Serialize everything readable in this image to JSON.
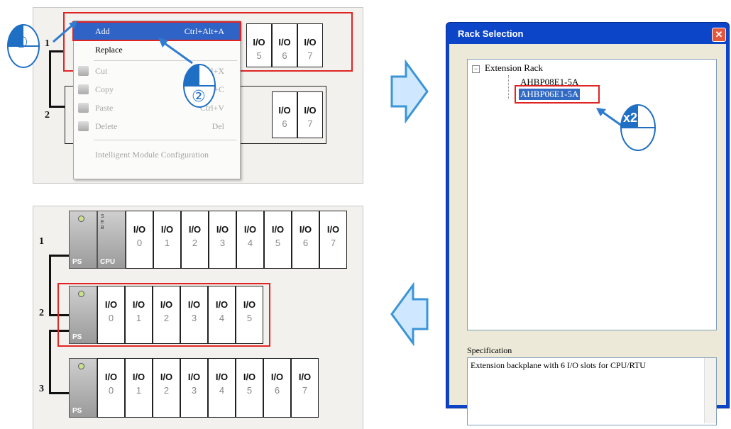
{
  "menu": {
    "items": [
      {
        "label": "Add",
        "shortcut": "Ctrl+Alt+A",
        "enabled": true,
        "highlighted": true
      },
      {
        "label": "Replace",
        "shortcut": "",
        "enabled": true
      },
      {
        "label": "Cut",
        "shortcut": "Ctrl+X",
        "enabled": false
      },
      {
        "label": "Copy",
        "shortcut": "Ctrl+C",
        "enabled": false
      },
      {
        "label": "Paste",
        "shortcut": "Ctrl+V",
        "enabled": false
      },
      {
        "label": "Delete",
        "shortcut": "Del",
        "enabled": false
      },
      {
        "label": "Intelligent Module Configuration",
        "shortcut": "",
        "enabled": false
      }
    ]
  },
  "steps": {
    "step1": "①",
    "step2": "②",
    "double_click": "x2"
  },
  "rack_labels": {
    "r1": "1",
    "r2": "2",
    "r3": "3",
    "ps": "PS",
    "cpu": "CPU",
    "cpu_ind": [
      "S",
      "E",
      "B"
    ]
  },
  "slot_label": "I/O",
  "top_rack": {
    "visible_slots": [
      "5",
      "6",
      "7"
    ],
    "row2_slots": [
      "6",
      "7"
    ]
  },
  "bottom_rack": {
    "row1": [
      "0",
      "1",
      "2",
      "3",
      "4",
      "5",
      "6",
      "7"
    ],
    "row2": [
      "0",
      "1",
      "2",
      "3",
      "4",
      "5"
    ],
    "row3": [
      "0",
      "1",
      "2",
      "3",
      "4",
      "5",
      "6",
      "7"
    ]
  },
  "dialog": {
    "title": "Rack Selection",
    "close": "✕",
    "tree_root": "Extension Rack",
    "tree_expand": "−",
    "tree_items": [
      "AHBP08E1-5A",
      "AHBP06E1-5A"
    ],
    "selected_index": 1,
    "spec_label": "Specification",
    "spec_text": "Extension backplane with 6 I/O slots for CPU/RTU"
  },
  "colors": {
    "highlight": "#e02424",
    "arrow_fill": "#cfe8ff",
    "arrow_stroke": "#3b95d6",
    "menu_hover": "#2f63c6"
  }
}
